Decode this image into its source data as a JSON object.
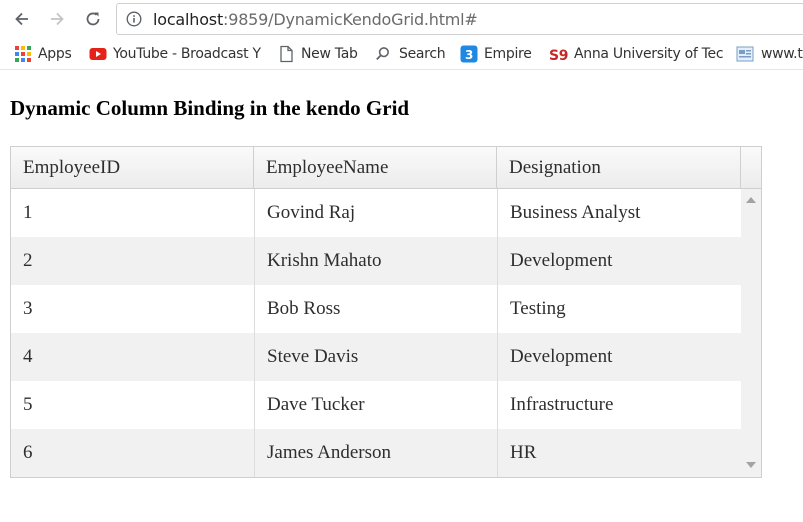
{
  "browser": {
    "url_host": "localhost",
    "url_rest": ":9859/DynamicKendoGrid.html#",
    "bookmarks": [
      {
        "label": "Apps",
        "icon": "apps-grid-icon"
      },
      {
        "label": "YouTube - Broadcast Y",
        "icon": "youtube-icon"
      },
      {
        "label": "New Tab",
        "icon": "page-icon"
      },
      {
        "label": "Search",
        "icon": "search-icon"
      },
      {
        "label": "Empire",
        "icon": "empire-icon"
      },
      {
        "label": "Anna University of Tec",
        "icon": "anna-university-icon"
      },
      {
        "label": "www.t",
        "icon": "site-icon"
      }
    ]
  },
  "page": {
    "title": "Dynamic Column Binding in the kendo Grid"
  },
  "grid": {
    "columns": [
      "EmployeeID",
      "EmployeeName",
      "Designation"
    ],
    "rows": [
      [
        "1",
        "Govind Raj",
        "Business Analyst"
      ],
      [
        "2",
        "Krishn Mahato",
        "Development"
      ],
      [
        "3",
        "Bob Ross",
        "Testing"
      ],
      [
        "4",
        "Steve Davis",
        "Development"
      ],
      [
        "5",
        "Dave Tucker",
        "Infrastructure"
      ],
      [
        "6",
        "James Anderson",
        "HR"
      ]
    ]
  },
  "colors": {
    "header_bg": "#ececec",
    "alt_row_bg": "#f1f1f1",
    "border": "#cfcfcf",
    "youtube_red": "#e62117",
    "empire_blue": "#1e88e5"
  }
}
